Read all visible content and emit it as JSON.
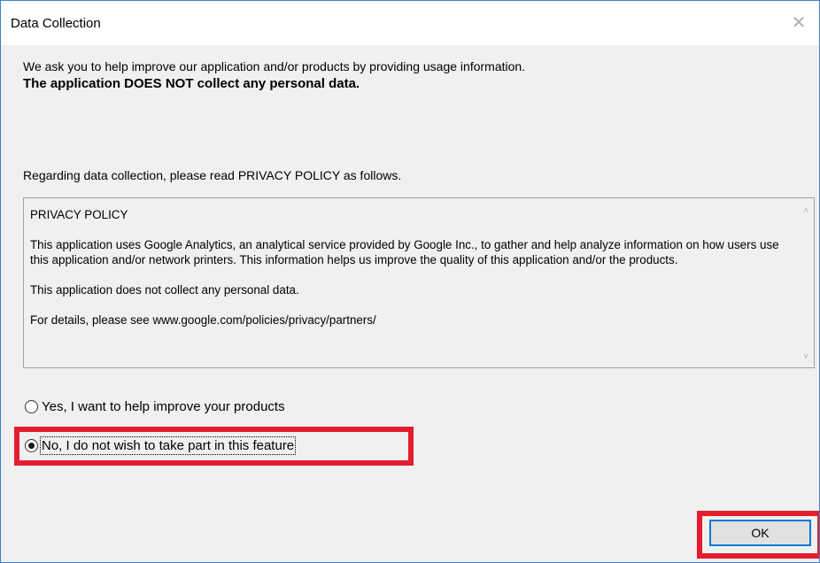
{
  "window": {
    "title": "Data Collection",
    "close_icon": "close-icon",
    "close_glyph": "✕"
  },
  "intro": {
    "line1": "We ask you to help improve our application and/or products by providing usage information.",
    "line2": "The application DOES NOT collect any personal data."
  },
  "regarding": "Regarding data collection, please read PRIVACY POLICY as follows.",
  "policy": {
    "heading": "PRIVACY POLICY",
    "paragraph1": "This application uses Google Analytics, an analytical service provided by Google Inc., to gather and help analyze information on how users use this application and/or network printers. This information helps us improve the quality of this application and/or the products.",
    "paragraph2": "This application does not collect any personal data.",
    "paragraph3": "For details, please see www.google.com/policies/privacy/partners/",
    "scroll_up_glyph": "∧",
    "scroll_down_glyph": "∨"
  },
  "options": {
    "yes_label": "Yes, I want to help improve your products",
    "no_label": "No, I do not wish to take part in this feature",
    "selected": "no"
  },
  "buttons": {
    "ok_label": "OK"
  },
  "colors": {
    "window_border": "#3f7fd3",
    "highlight": "#e41d2e",
    "button_focus": "#0078d7",
    "dialog_bg": "#f0f0f0"
  }
}
